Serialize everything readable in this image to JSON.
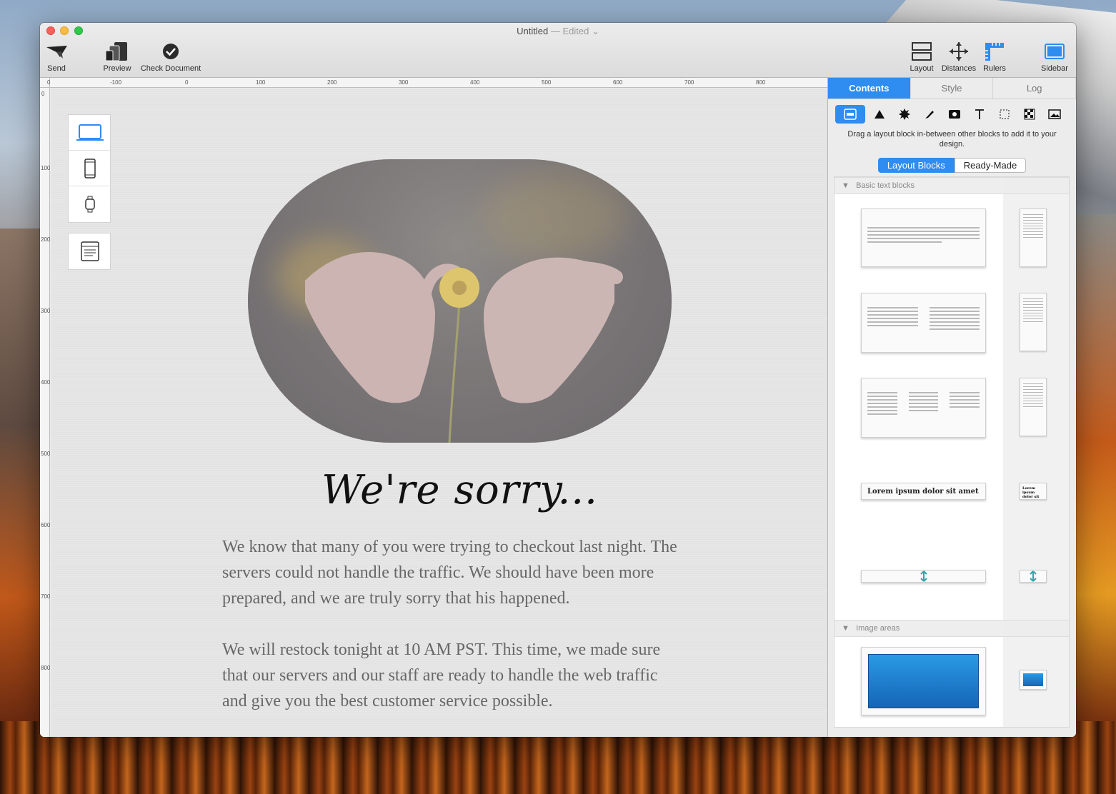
{
  "window": {
    "title": "Untitled",
    "edited": "— Edited ⌄"
  },
  "toolbar": {
    "send": "Send",
    "preview": "Preview",
    "check": "Check Document",
    "layout": "Layout",
    "distances": "Distances",
    "rulers": "Rulers",
    "sidebar": "Sidebar"
  },
  "ruler": {
    "top_labels": [
      "0",
      "-100",
      "0",
      "100",
      "200",
      "300",
      "400",
      "500",
      "600",
      "700",
      "800"
    ],
    "left_labels": [
      "0",
      "100",
      "200",
      "300",
      "400",
      "500",
      "600",
      "700",
      "800"
    ]
  },
  "devices": [
    "laptop-icon",
    "phone-icon",
    "watch-icon",
    "web-window-icon"
  ],
  "content": {
    "heading": "We're sorry...",
    "para1": "We know that many of you were trying to checkout last night. The servers could not handle the traffic. We should have been more prepared, and we are truly sorry that his happened.",
    "para2": "We will restock tonight at 10 AM PST. This time, we made sure that our servers and our staff are ready to handle the web traffic and give you the best customer service possible."
  },
  "sidebar": {
    "tabs": [
      "Contents",
      "Style",
      "Log"
    ],
    "active_tab": "Contents",
    "tool_icons": [
      "layout-block-icon",
      "triangle-icon",
      "starburst-icon",
      "pen-icon",
      "image-icon",
      "text-icon",
      "selection-icon",
      "pattern-icon",
      "picture-icon"
    ],
    "help": "Drag a layout block in-between other blocks to add it to your design.",
    "segment": [
      "Layout Blocks",
      "Ready-Made"
    ],
    "sections": [
      "Basic text blocks",
      "Image areas"
    ],
    "lorem": "Lorem ipsum dolor sit amet",
    "lorem_short": "Lorem ipsum dolor sit amet"
  },
  "colors": {
    "accent": "#2f8cf0",
    "body_text": "#676767"
  }
}
